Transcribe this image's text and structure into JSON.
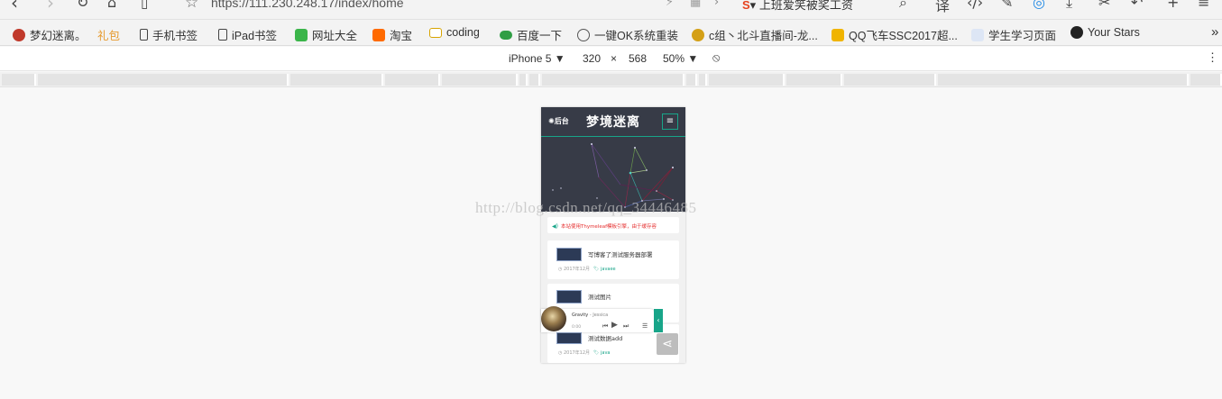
{
  "browser": {
    "url": "https://111.230.248.17/index/home",
    "ticker": "上班爱笑被奖工资"
  },
  "bookmarks": [
    {
      "label": "梦幻迷离。",
      "icon": "avatar-icon",
      "color": "#c0392b"
    },
    {
      "label": "礼包",
      "icon": "none",
      "color": "#e69a2e"
    },
    {
      "label": "手机书签",
      "icon": "phone-icon",
      "color": "#444444"
    },
    {
      "label": "iPad书签",
      "icon": "tablet-icon",
      "color": "#444444"
    },
    {
      "label": "网址大全",
      "icon": "hao-icon",
      "color": "#3bb54a"
    },
    {
      "label": "淘宝",
      "icon": "taobao-icon",
      "color": "#ff6a00"
    },
    {
      "label": "coding",
      "icon": "folder-icon",
      "color": "#f1c232"
    },
    {
      "label": "百度一下",
      "icon": "gamepad-icon",
      "color": "#2f9e44"
    },
    {
      "label": "一键OK系统重装",
      "icon": "globe-icon",
      "color": "#555555"
    },
    {
      "label": "c组丶北斗直播间-龙...",
      "icon": "face-icon",
      "color": "#d4a017"
    },
    {
      "label": "QQ飞车SSC2017超...",
      "icon": "qq-icon",
      "color": "#f0b400"
    },
    {
      "label": "学生学习页面",
      "icon": "blank-icon",
      "color": "#dde6f5"
    },
    {
      "label": "Your Stars",
      "icon": "github-icon",
      "color": "#222222"
    }
  ],
  "device_toolbar": {
    "device": "iPhone 5",
    "width": "320",
    "times": "×",
    "height": "568",
    "zoom": "50%"
  },
  "site": {
    "admin_label": "✺后台",
    "title": "梦境迷离",
    "menu_icon": "≡",
    "notice": "本站使用Thymeleaf模板引擎，由于缓存容",
    "posts": [
      {
        "title": "写博客了测试服务器部署",
        "date": "2017年12月",
        "tag": "javaee"
      },
      {
        "title": "测试图片",
        "date": "",
        "tag": ""
      },
      {
        "title": "测试数据add",
        "date": "2017年12月",
        "tag": "java"
      }
    ],
    "player": {
      "song": "Gravity",
      "artist": "- Jessica",
      "time": "0:00"
    }
  },
  "watermark": "http://blog.csdn.net/qq_34446485",
  "colors": {
    "accent": "#18a589",
    "header_bg": "#373b47",
    "notice_text": "#e52d2d"
  }
}
